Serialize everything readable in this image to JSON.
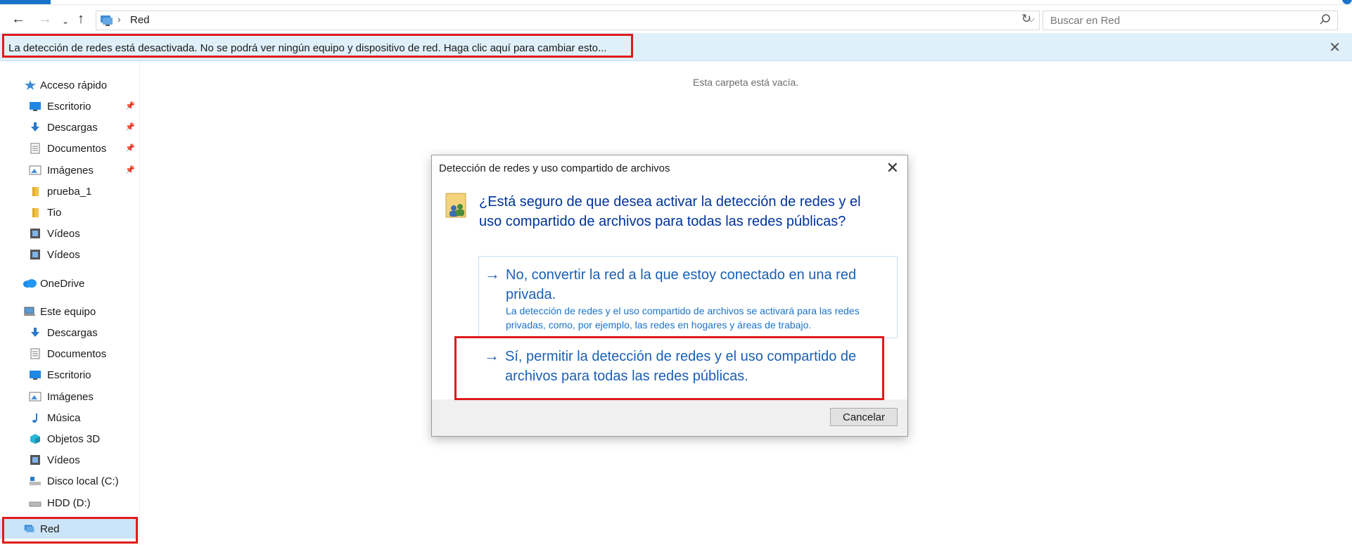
{
  "address": {
    "path": "Red",
    "separator": "›"
  },
  "search": {
    "placeholder": "Buscar en Red"
  },
  "infobar": {
    "message": "La detección de redes está desactivada. No se podrá ver ningún equipo y dispositivo de red. Haga clic aquí para cambiar esto..."
  },
  "sidebar": {
    "quick_access": "Acceso rápido",
    "quick_items": [
      {
        "label": "Escritorio",
        "icon": "desktop-icon",
        "pinned": true
      },
      {
        "label": "Descargas",
        "icon": "downloads-icon",
        "pinned": true
      },
      {
        "label": "Documentos",
        "icon": "documents-icon",
        "pinned": true
      },
      {
        "label": "Imágenes",
        "icon": "pictures-icon",
        "pinned": true
      },
      {
        "label": "prueba_1",
        "icon": "folder-icon",
        "pinned": false
      },
      {
        "label": "Tio",
        "icon": "folder-icon",
        "pinned": false
      },
      {
        "label": "Vídeos",
        "icon": "videos-icon",
        "pinned": false
      },
      {
        "label": "Vídeos",
        "icon": "videos-icon",
        "pinned": false
      }
    ],
    "onedrive": "OneDrive",
    "this_pc": "Este equipo",
    "pc_items": [
      {
        "label": "Descargas",
        "icon": "downloads-icon"
      },
      {
        "label": "Documentos",
        "icon": "documents-icon"
      },
      {
        "label": "Escritorio",
        "icon": "desktop-icon"
      },
      {
        "label": "Imágenes",
        "icon": "pictures-icon"
      },
      {
        "label": "Música",
        "icon": "music-icon"
      },
      {
        "label": "Objetos 3D",
        "icon": "3d-objects-icon"
      },
      {
        "label": "Vídeos",
        "icon": "videos-icon"
      },
      {
        "label": "Disco local (C:)",
        "icon": "drive-c-icon"
      },
      {
        "label": "HDD (D:)",
        "icon": "drive-d-icon"
      }
    ],
    "network": "Red"
  },
  "content": {
    "empty_text": "Esta carpeta está vacía."
  },
  "dialog": {
    "title": "Detección de redes y uso compartido de archivos",
    "question": "¿Está seguro de que desea activar la detección de redes y el uso compartido de archivos para todas las redes públicas?",
    "option_no": {
      "main": "No, convertir la red a la que estoy conectado en una red privada.",
      "sub": "La detección de redes y el uso compartido de archivos se activará para las redes privadas, como, por ejemplo, las redes en hogares y áreas de trabajo."
    },
    "option_yes": {
      "main": "Sí, permitir la detección de redes y el uso compartido de archivos para todas las redes públicas."
    },
    "cancel": "Cancelar"
  },
  "colors": {
    "link": "#1a5fb4",
    "question": "#003399",
    "highlight": "#e01b1b",
    "infobar": "#dff0fb"
  }
}
